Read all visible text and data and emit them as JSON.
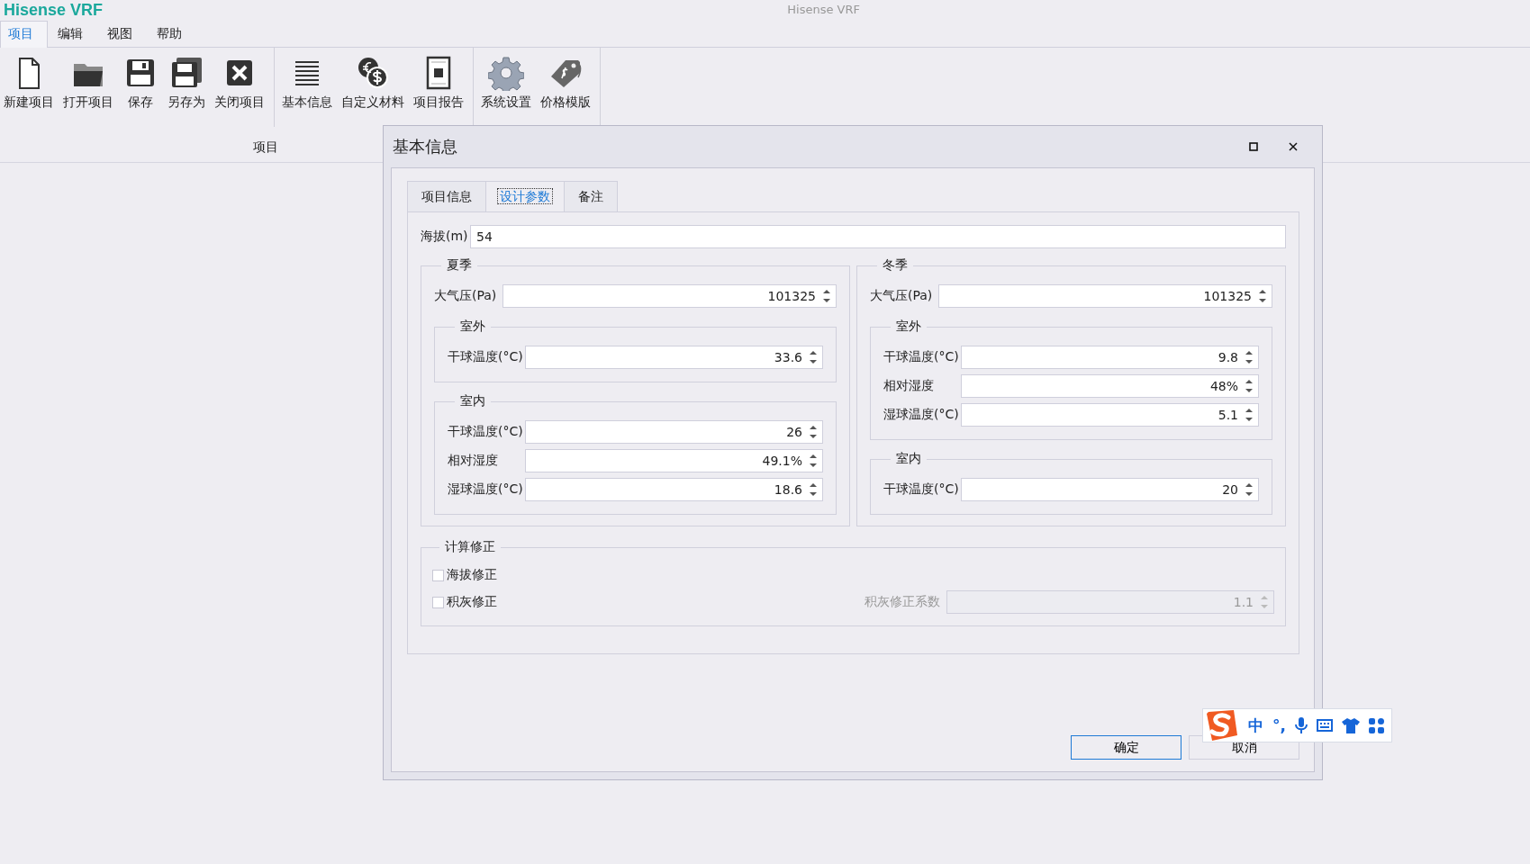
{
  "app": {
    "logo": "Hisense VRF",
    "title": "Hisense VRF"
  },
  "menu": [
    {
      "label": "项目",
      "selected": true
    },
    {
      "label": "编辑",
      "selected": false
    },
    {
      "label": "视图",
      "selected": false
    },
    {
      "label": "帮助",
      "selected": false
    }
  ],
  "ribbon": {
    "sections": [
      [
        {
          "label": "新建项目"
        },
        {
          "label": "打开项目"
        },
        {
          "label": "保存"
        },
        {
          "label": "另存为"
        },
        {
          "label": "关闭项目"
        }
      ],
      [
        {
          "label": "基本信息"
        },
        {
          "label": "自定义材料"
        },
        {
          "label": "项目报告"
        }
      ],
      [
        {
          "label": "系统设置"
        },
        {
          "label": "价格模版"
        }
      ]
    ],
    "group_label": "项目"
  },
  "dialog": {
    "title": "基本信息",
    "tabs": [
      {
        "label": "项目信息",
        "selected": false
      },
      {
        "label": "设计参数",
        "selected": true
      },
      {
        "label": "备注",
        "selected": false
      }
    ],
    "altitude": {
      "label": "海拔(m)",
      "value": "54"
    },
    "seasons": [
      {
        "title": "夏季",
        "pressure": {
          "label": "大气压(Pa)",
          "value": "101325"
        },
        "groups": [
          {
            "title": "室外",
            "fields": [
              {
                "label": "干球温度(°C)",
                "value": "33.6"
              }
            ]
          },
          {
            "title": "室内",
            "fields": [
              {
                "label": "干球温度(°C)",
                "value": "26"
              },
              {
                "label": "相对湿度",
                "value": "49.1%"
              },
              {
                "label": "湿球温度(°C)",
                "value": "18.6"
              }
            ]
          }
        ]
      },
      {
        "title": "冬季",
        "pressure": {
          "label": "大气压(Pa)",
          "value": "101325"
        },
        "groups": [
          {
            "title": "室外",
            "fields": [
              {
                "label": "干球温度(°C)",
                "value": "9.8"
              },
              {
                "label": "相对湿度",
                "value": "48%"
              },
              {
                "label": "湿球温度(°C)",
                "value": "5.1"
              }
            ]
          },
          {
            "title": "室内",
            "fields": [
              {
                "label": "干球温度(°C)",
                "value": "20"
              }
            ]
          }
        ]
      }
    ],
    "correction": {
      "title": "计算修正",
      "options": [
        {
          "label": "海拔修正",
          "checked": false
        },
        {
          "label": "积灰修正",
          "checked": false
        }
      ],
      "coefficient": {
        "label": "积灰修正系数",
        "value": "1.1",
        "disabled": true
      }
    },
    "buttons": [
      {
        "label": "确定",
        "default": true
      },
      {
        "label": "取消",
        "default": false
      }
    ]
  },
  "ime": {
    "items": [
      {
        "kind": "logo"
      },
      {
        "kind": "text",
        "text": "中"
      },
      {
        "kind": "text",
        "text": "°,"
      },
      {
        "kind": "mic"
      },
      {
        "kind": "keyboard"
      },
      {
        "kind": "shirt"
      },
      {
        "kind": "apps"
      }
    ]
  }
}
